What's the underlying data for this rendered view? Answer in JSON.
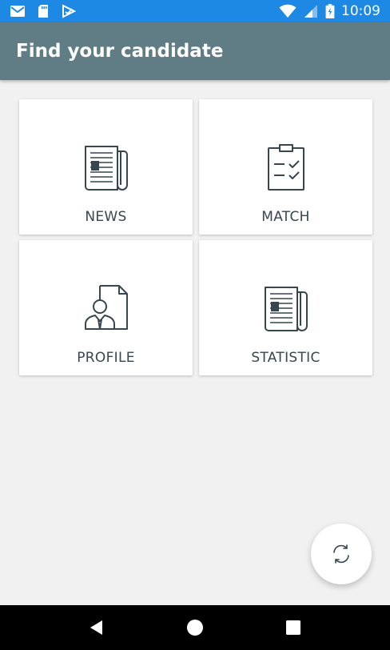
{
  "status_bar": {
    "time": "10:09",
    "icons": [
      "gmail-icon",
      "sd-card-icon",
      "play-store-icon",
      "wifi-icon",
      "signal-icon",
      "battery-icon"
    ]
  },
  "app_bar": {
    "title": "Find your candidate"
  },
  "cards": [
    {
      "label": "NEWS",
      "icon": "newspaper-icon"
    },
    {
      "label": "MATCH",
      "icon": "clipboard-check-icon"
    },
    {
      "label": "PROFILE",
      "icon": "profile-document-icon"
    },
    {
      "label": "STATISTIC",
      "icon": "newspaper-icon"
    }
  ],
  "fab": {
    "icon": "refresh-icon"
  },
  "nav_bar": {
    "icons": [
      "back-icon",
      "home-icon",
      "recents-icon"
    ]
  },
  "colors": {
    "status_bar": "#1e88e5",
    "app_bar": "#607d86",
    "background": "#f1f1f1",
    "icon_stroke": "#37474f"
  }
}
